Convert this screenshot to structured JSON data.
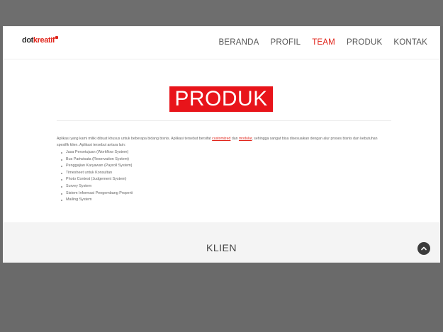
{
  "header": {
    "logo": {
      "prefix": "dot",
      "suffix": "kreatif"
    },
    "nav": [
      "BERANDA",
      "PROFIL",
      "TEAM",
      "PRODUK",
      "KONTAK"
    ],
    "active_nav": "TEAM",
    "accent_color": "#e1251b"
  },
  "main": {
    "title": "PRODUK",
    "intro": {
      "part1": "Aplikasi yang kami miliki dibuat khusus untuk beberapa bidang bisnis. Aplikasi tersebut bersifat ",
      "link1": "customized",
      "part2": " dan ",
      "link2": "modular",
      "part3": ", sehingga sangat bisa disesuaikan dengan alur proses bisnis dan kebutuhan spesifik klien. Aplikasi tersebut antara lain:"
    },
    "products": [
      "Jasa Persetujuan (Workflow System)",
      "Bus Pariwisata (Reservation System)",
      "Penggajian Karyawan (Payroll System)",
      "Timesheet untuk Konsultan",
      "Photo Contest (Judgement System)",
      "Survey System",
      "Sistem Informasi Pengembang Properti",
      "Mailing System"
    ]
  },
  "klien": {
    "title": "KLIEN"
  },
  "icons": {
    "scroll_top": "chevron-up-icon"
  }
}
